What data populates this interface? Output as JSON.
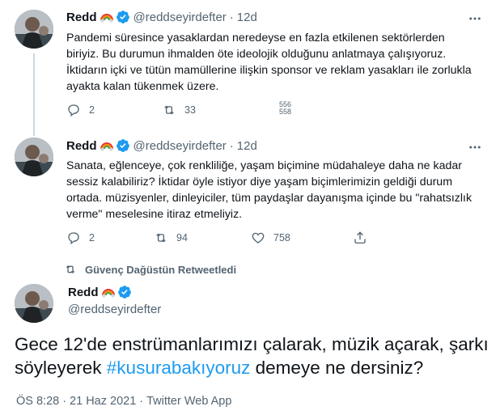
{
  "tweets": [
    {
      "name": "Redd",
      "handle": "@reddseyirdefter",
      "dot": "·",
      "time": "12d",
      "text": "Pandemi süresince yasaklardan neredeyse en fazla etkilenen sektörlerden biriyiz. Bu durumun ihmalden öte ideolojik olduğunu anlatmaya çalışıyoruz. İktidarın içki ve tütün mamüllerine ilişkin sponsor ve reklam yasakları ile zorlukla ayakta kalan tükenmek üzere.",
      "replies": "2",
      "retweets": "33",
      "likes_partial_top": "556",
      "likes_partial_bottom": "558"
    },
    {
      "name": "Redd",
      "handle": "@reddseyirdefter",
      "dot": "·",
      "time": "12d",
      "text": "Sanata, eğlenceye, çok renkliliğe, yaşam biçimine müdahaleye daha ne kadar sessiz kalabiliriz? İktidar öyle istiyor diye yaşam biçimlerimizin geldiği durum ortada. müzisyenler, dinleyiciler, tüm paydaşlar dayanışma içinde bu \"rahatsızlık verme\" meselesine itiraz etmeliyiz.",
      "replies": "2",
      "retweets": "94",
      "likes": "758"
    }
  ],
  "retweeted_by": "Güvenç Dağüstün Retweetledi",
  "main": {
    "name": "Redd",
    "handle": "@reddseyirdefter",
    "text_before": "Gece 12'de enstrümanlarımızı çalarak, müzik açarak, şarkı söyleyerek ",
    "hashtag": "#kusurabakıyoruz",
    "text_after": " demeye ne dersiniz?",
    "time": "ÖS 8:28",
    "date": "21 Haz 2021",
    "sep": "·",
    "source": "Twitter Web App"
  },
  "icons": {
    "verified": "verified-badge-icon",
    "emoji": "rainbow-emoji-icon",
    "more": "more-dots-icon",
    "reply": "reply-icon",
    "retweet": "retweet-icon",
    "like": "heart-icon",
    "share": "share-icon"
  },
  "colors": {
    "accent": "#1d9bf0",
    "secondary_text": "#536471",
    "retweet_green": "#00ba7c"
  }
}
